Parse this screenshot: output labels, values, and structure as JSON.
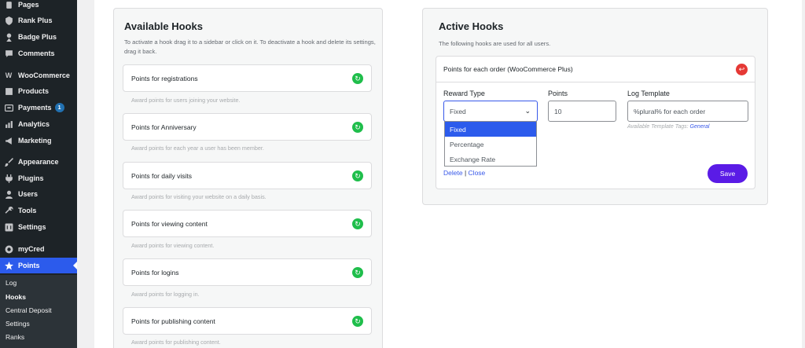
{
  "sidebar": {
    "items": [
      {
        "label": "Pages",
        "icon": "pages-icon"
      },
      {
        "label": "Rank Plus",
        "icon": "shield-icon"
      },
      {
        "label": "Badge Plus",
        "icon": "badge-icon"
      },
      {
        "label": "Comments",
        "icon": "comment-icon"
      },
      {
        "label": "WooCommerce",
        "icon": "woocommerce-icon"
      },
      {
        "label": "Products",
        "icon": "products-icon"
      },
      {
        "label": "Payments",
        "icon": "payments-icon",
        "badge": "1"
      },
      {
        "label": "Analytics",
        "icon": "analytics-icon"
      },
      {
        "label": "Marketing",
        "icon": "megaphone-icon"
      },
      {
        "label": "Appearance",
        "icon": "brush-icon"
      },
      {
        "label": "Plugins",
        "icon": "plugin-icon"
      },
      {
        "label": "Users",
        "icon": "user-icon"
      },
      {
        "label": "Tools",
        "icon": "wrench-icon"
      },
      {
        "label": "Settings",
        "icon": "settings-icon"
      },
      {
        "label": "myCred",
        "icon": "mycred-icon"
      },
      {
        "label": "Points",
        "icon": "star-icon"
      }
    ],
    "submenu": [
      "Log",
      "Hooks",
      "Central Deposit",
      "Settings",
      "Ranks"
    ]
  },
  "available": {
    "title": "Available Hooks",
    "description": "To activate a hook drag it to a sidebar or click on it. To deactivate a hook and delete its settings, drag it back.",
    "hooks": [
      {
        "label": "Points for registrations",
        "desc": "Award points for users joining your website."
      },
      {
        "label": "Points for Anniversary",
        "desc": "Award points for each year a user has been member."
      },
      {
        "label": "Points for daily visits",
        "desc": "Award points for visiting your website on a daily basis."
      },
      {
        "label": "Points for viewing content",
        "desc": "Award points for viewing content."
      },
      {
        "label": "Points for logins",
        "desc": "Award points for logging in."
      },
      {
        "label": "Points for publishing content",
        "desc": "Award points for publishing content."
      }
    ]
  },
  "active": {
    "title": "Active Hooks",
    "description": "The following hooks are used for all users.",
    "card": {
      "title": "Points for each order (WooCommerce Plus)",
      "reward_type_label": "Reward Type",
      "reward_type_value": "Fixed",
      "reward_options": [
        "Fixed",
        "Percentage",
        "Exchange Rate"
      ],
      "points_label": "Points",
      "points_value": "10",
      "log_label": "Log Template",
      "log_value": "%plural% for each order",
      "tags_prefix": "Available Template Tags: ",
      "tags_link": "General",
      "delete_label": "Delete",
      "separator": "|",
      "close_label": "Close",
      "save_label": "Save"
    }
  },
  "colors": {
    "sidebar_bg": "#1d2327",
    "current_menu": "#2c5bec",
    "hook_button": "#1fbe4b",
    "remove_button": "#e53935",
    "save_button": "#5a1be6"
  }
}
